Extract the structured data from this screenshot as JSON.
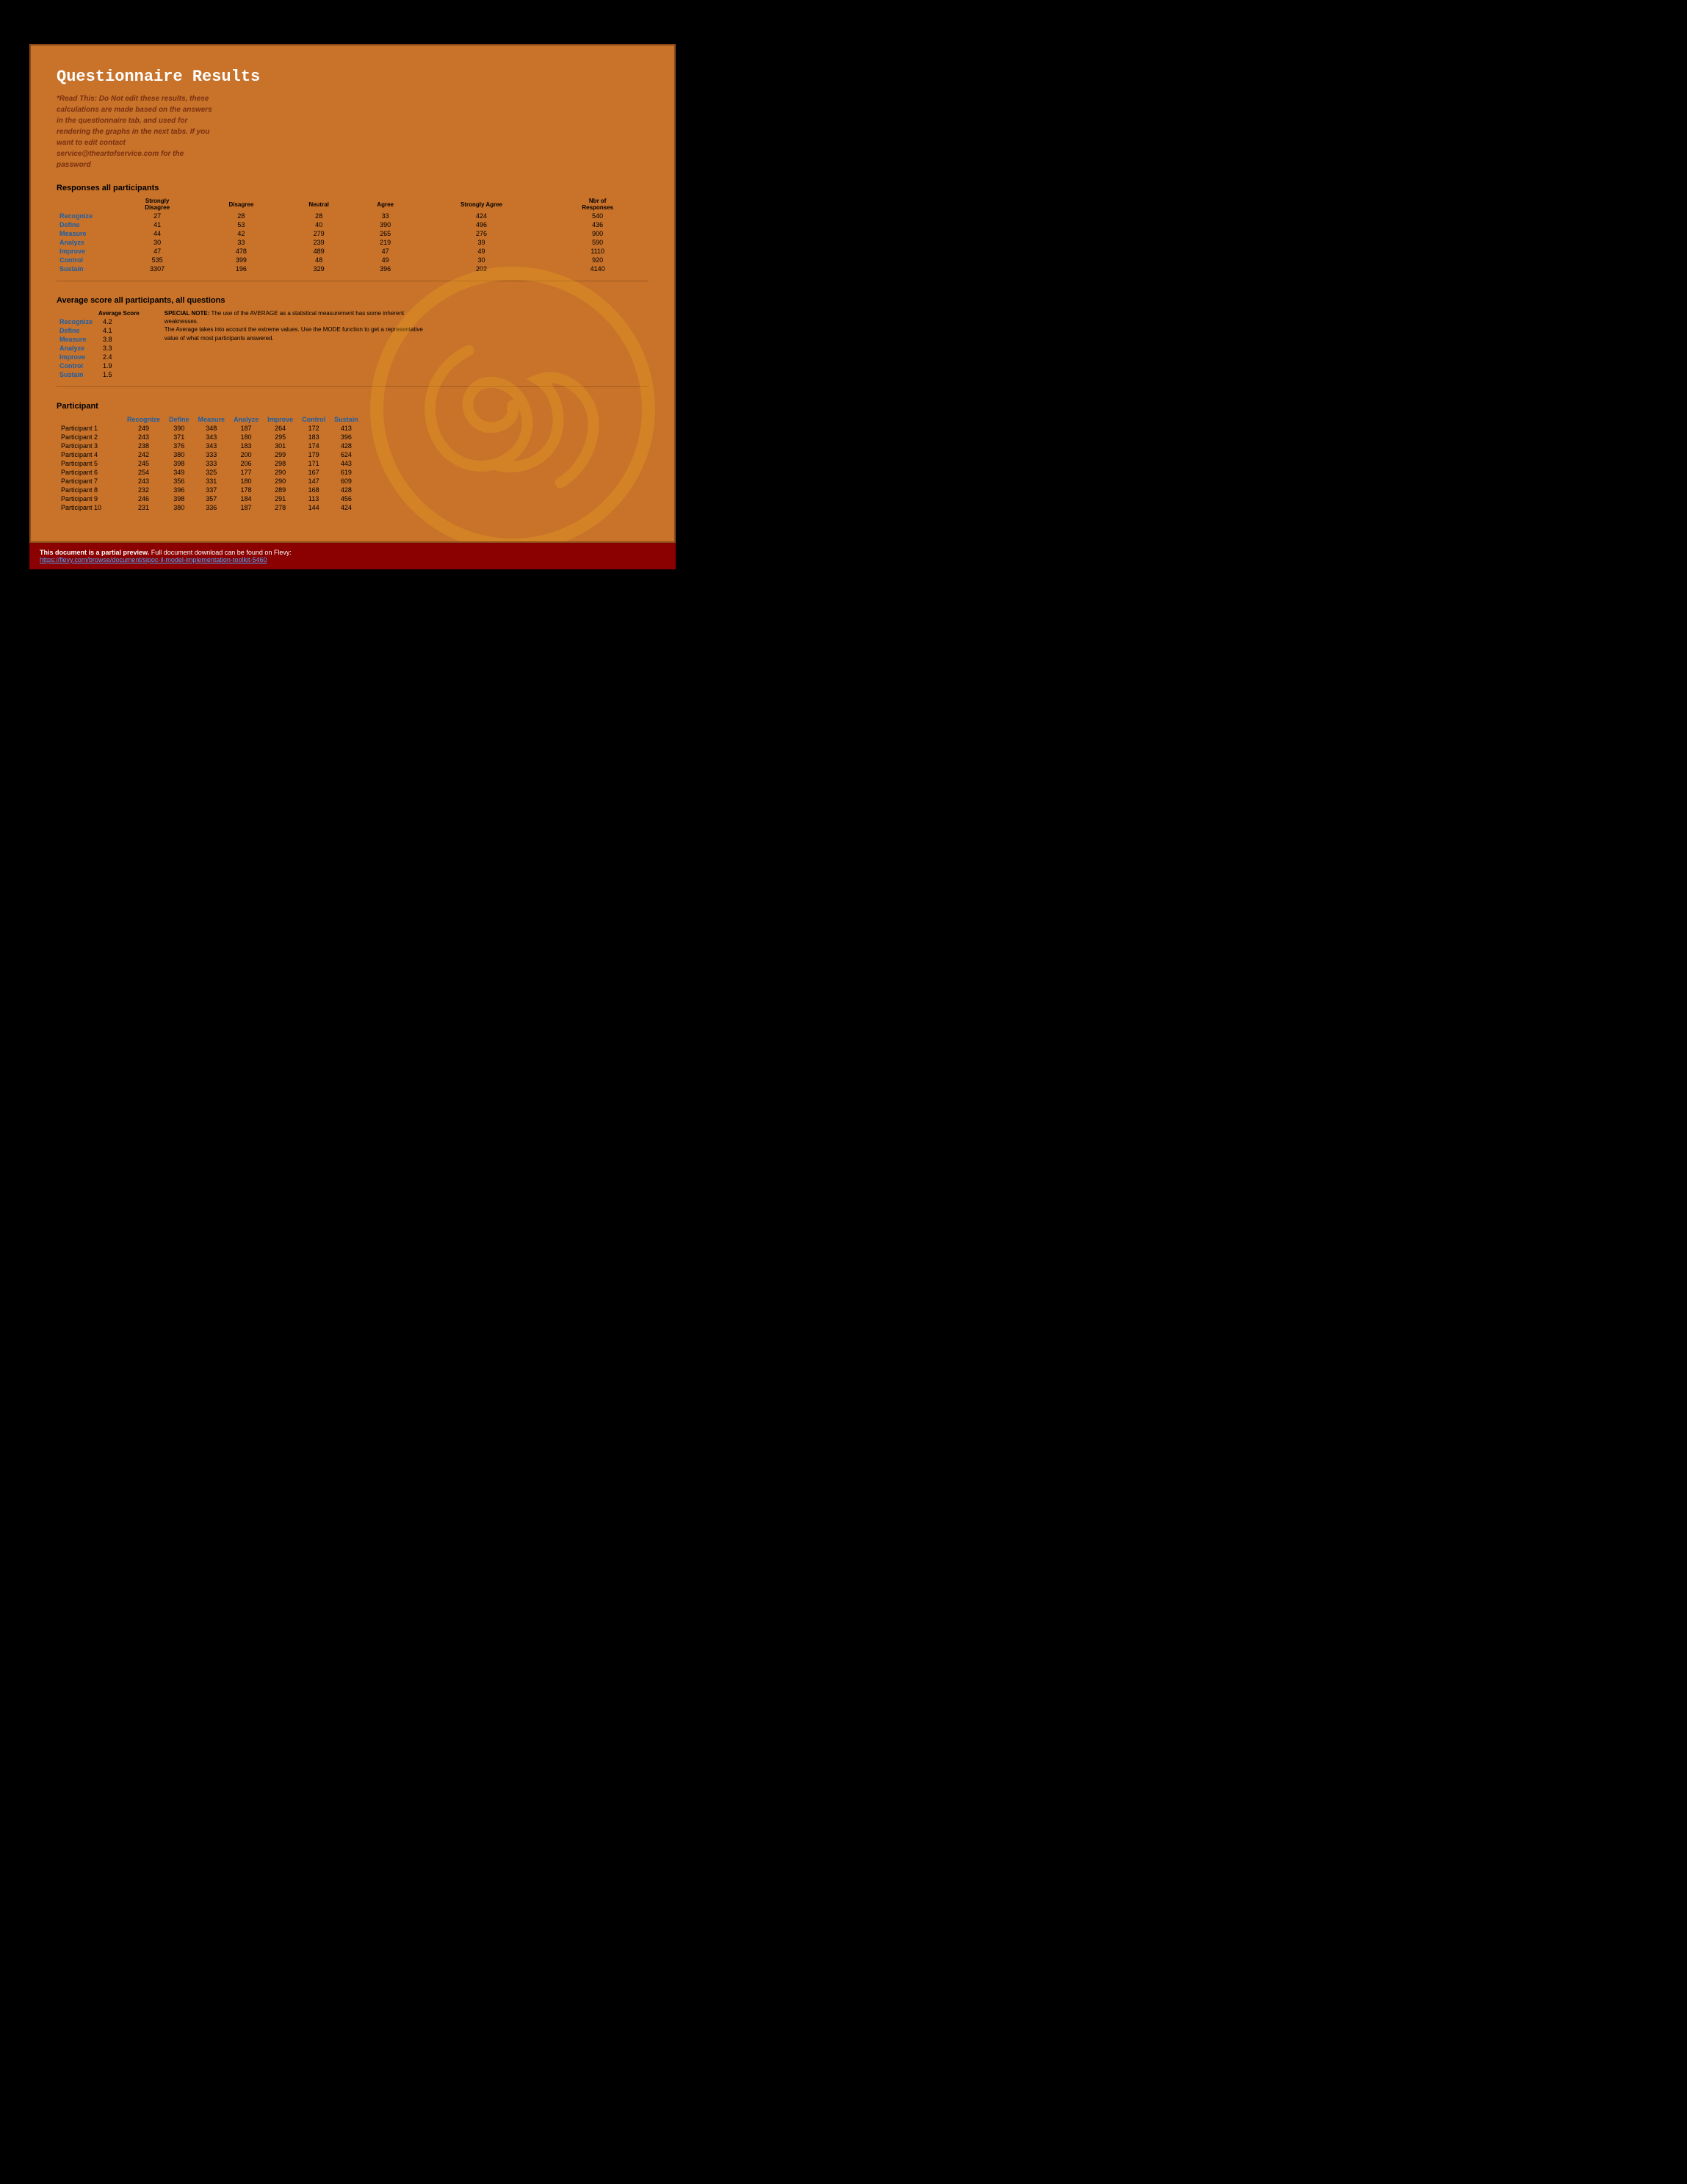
{
  "page": {
    "title": "Questionnaire Results",
    "subtitle": "*Read This: Do Not edit these results, these calculations are made based on the answers in the questionnaire tab, and used for rendering the graphs in the next tabs. If you want to edit contact service@theartofservice.com for the password",
    "responses_section": {
      "title": "Responses all participants",
      "headers": {
        "col1": "",
        "strongly_disagree": "Strongly Disagree",
        "disagree": "Disagree",
        "neutral": "Neutral",
        "agree": "Agree",
        "strongly_agree": "Strongly Agree",
        "nbr_responses": "Nbr of Responses"
      },
      "rows": [
        {
          "label": "Recognize",
          "sd": 27,
          "d": 28,
          "n": 28,
          "a": 33,
          "sa": 424,
          "nbr": 540
        },
        {
          "label": "Define",
          "sd": 41,
          "d": 53,
          "n": 40,
          "a": 390,
          "sa": 496,
          "nbr": 436
        },
        {
          "label": "Measure",
          "sd": 44,
          "d": 42,
          "n": 279,
          "a": 265,
          "sa": 276,
          "nbr": 900
        },
        {
          "label": "Analyze",
          "sd": 30,
          "d": 33,
          "n": 239,
          "a": 219,
          "sa": 39,
          "nbr": 590
        },
        {
          "label": "Improve",
          "sd": 47,
          "d": 478,
          "n": 489,
          "a": 47,
          "sa": 49,
          "nbr": 1110
        },
        {
          "label": "Control",
          "sd": 535,
          "d": 399,
          "n": 48,
          "a": 49,
          "sa": 30,
          "nbr": 920
        },
        {
          "label": "Sustain",
          "sd": 3307,
          "d": 196,
          "n": 329,
          "a": 396,
          "sa": 202,
          "nbr": 4140
        }
      ]
    },
    "avg_section": {
      "title": "Average score all participants, all questions",
      "col_header": "Average Score",
      "rows": [
        {
          "label": "Recognize",
          "score": "4.2"
        },
        {
          "label": "Define",
          "score": "4.1"
        },
        {
          "label": "Measure",
          "score": "3.8"
        },
        {
          "label": "Analyze",
          "score": "3.3"
        },
        {
          "label": "Improve",
          "score": "2.4"
        },
        {
          "label": "Control",
          "score": "1.9"
        },
        {
          "label": "Sustain",
          "score": "1.5"
        }
      ],
      "special_note_title": "SPECIAL NOTE:",
      "special_note": "The use of the AVERAGE as a statistical measurement has some inherent weaknesses.",
      "special_note_detail": "The Average takes into account the extreme values. Use the MODE function to get a representative value of what most participants answered."
    },
    "participant_section": {
      "title": "Participant",
      "headers": [
        "",
        "Recognize",
        "Define",
        "Measure",
        "Analyze",
        "Improve",
        "Control",
        "Sustain"
      ],
      "rows": [
        {
          "name": "Participant 1",
          "rec": 249,
          "def": 390,
          "mea": 348,
          "ana": 187,
          "imp": 264,
          "con": 172,
          "sus": 413
        },
        {
          "name": "Participant 2",
          "rec": 243,
          "def": 371,
          "mea": 343,
          "ana": 180,
          "imp": 295,
          "con": 183,
          "sus": 396
        },
        {
          "name": "Participant 3",
          "rec": 238,
          "def": 376,
          "mea": 343,
          "ana": 183,
          "imp": 301,
          "con": 174,
          "sus": 428
        },
        {
          "name": "Participant 4",
          "rec": 242,
          "def": 380,
          "mea": 333,
          "ana": 200,
          "imp": 299,
          "con": 179,
          "sus": 624
        },
        {
          "name": "Participant 5",
          "rec": 245,
          "def": 398,
          "mea": 333,
          "ana": 206,
          "imp": 298,
          "con": 171,
          "sus": 443
        },
        {
          "name": "Participant 6",
          "rec": 254,
          "def": 349,
          "mea": 325,
          "ana": 177,
          "imp": 290,
          "con": 167,
          "sus": 619
        },
        {
          "name": "Participant 7",
          "rec": 243,
          "def": 356,
          "mea": 331,
          "ana": 180,
          "imp": 290,
          "con": 147,
          "sus": 609
        },
        {
          "name": "Participant 8",
          "rec": 232,
          "def": 396,
          "mea": 337,
          "ana": 178,
          "imp": 289,
          "con": 168,
          "sus": 428
        },
        {
          "name": "Participant 9",
          "rec": 246,
          "def": 398,
          "mea": 357,
          "ana": 184,
          "imp": 291,
          "con": 113,
          "sus": 456
        },
        {
          "name": "Participant 10",
          "rec": 231,
          "def": 380,
          "mea": 336,
          "ana": 187,
          "imp": 278,
          "con": 144,
          "sus": 424
        }
      ]
    },
    "footer": {
      "partial_text": "This document is a partial preview.",
      "full_text": " Full document download can be found on Flevy:",
      "link_text": "https://flevy.com/browse/document/sipoc-il-model-implementation-toolkit-5460",
      "link_url": "https://flevy.com/browse/document/sipoc-il-model-implementation-toolkit-5460"
    }
  }
}
